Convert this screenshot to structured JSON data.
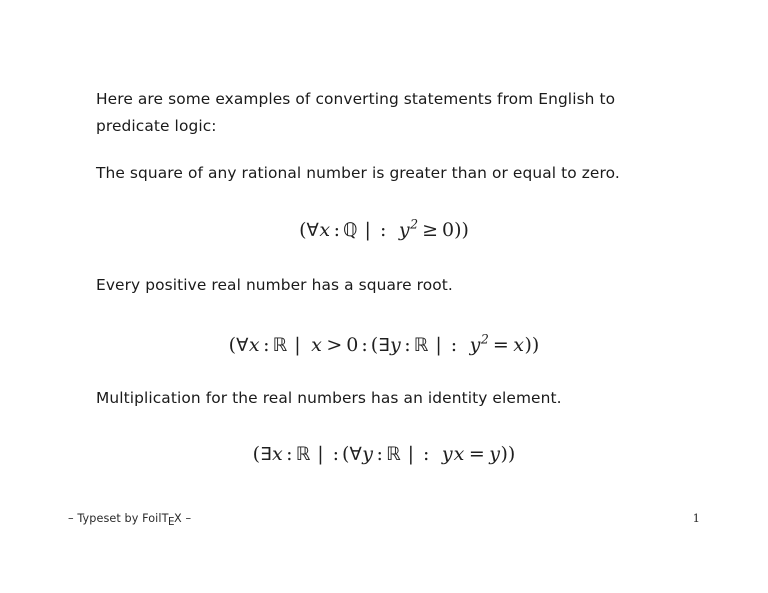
{
  "document": {
    "type": "presentation-slide",
    "background_color": "#ffffff",
    "text_color": "#1a1a1a"
  },
  "intro": {
    "line1": "Here are some examples of converting statements from English to",
    "line2": "predicate logic:"
  },
  "items": [
    {
      "statement": "The square of any rational number is greater than or equal to zero.",
      "formula_plain": "(∀x : ℚ  | :   y² ≥ 0))",
      "formula_parts": {
        "open_paren": "(",
        "quantifier": "∀",
        "bound_var": "x",
        "colon1": ":",
        "domain": "ℚ",
        "bar": "|",
        "colon2": ":",
        "body_var": "y",
        "exponent": "2",
        "relation": "≥",
        "rhs": "0",
        "close": "))"
      }
    },
    {
      "statement": "Every positive real number has a square root.",
      "formula_plain": "(∀x : ℝ  |  x > 0 : (∃y : ℝ  | :   y² = x))",
      "formula_parts": {
        "open_paren": "(",
        "quantifier": "∀",
        "bound_var": "x",
        "colon1": ":",
        "domain": "ℝ",
        "bar": "|",
        "range_lhs": "x",
        "range_rel": ">",
        "range_rhs": "0",
        "colon2": ":",
        "inner_open": "(",
        "inner_quantifier": "∃",
        "inner_var": "y",
        "inner_colon1": ":",
        "inner_domain": "ℝ",
        "inner_bar": "|",
        "inner_colon2": ":",
        "body_var": "y",
        "exponent": "2",
        "relation": "=",
        "rhs": "x",
        "close": "))"
      }
    },
    {
      "statement": "Multiplication for the real numbers has an identity element.",
      "formula_plain": "(∃x : ℝ  | : (∀y : ℝ  | :   yx = y))",
      "formula_parts": {
        "open_paren": "(",
        "quantifier": "∃",
        "bound_var": "x",
        "colon1": ":",
        "domain": "ℝ",
        "bar": "|",
        "colon2": ":",
        "inner_open": "(",
        "inner_quantifier": "∀",
        "inner_var": "y",
        "inner_colon1": ":",
        "inner_domain": "ℝ",
        "inner_bar": "|",
        "inner_colon2": ":",
        "body_lhs_a": "y",
        "body_lhs_b": "x",
        "relation": "=",
        "rhs": "y",
        "close": "))"
      }
    }
  ],
  "footer": {
    "prefix": "– Typeset by Foil",
    "tex_t": "T",
    "tex_e": "E",
    "tex_x": "X",
    "suffix": "–",
    "page_number": "1"
  }
}
